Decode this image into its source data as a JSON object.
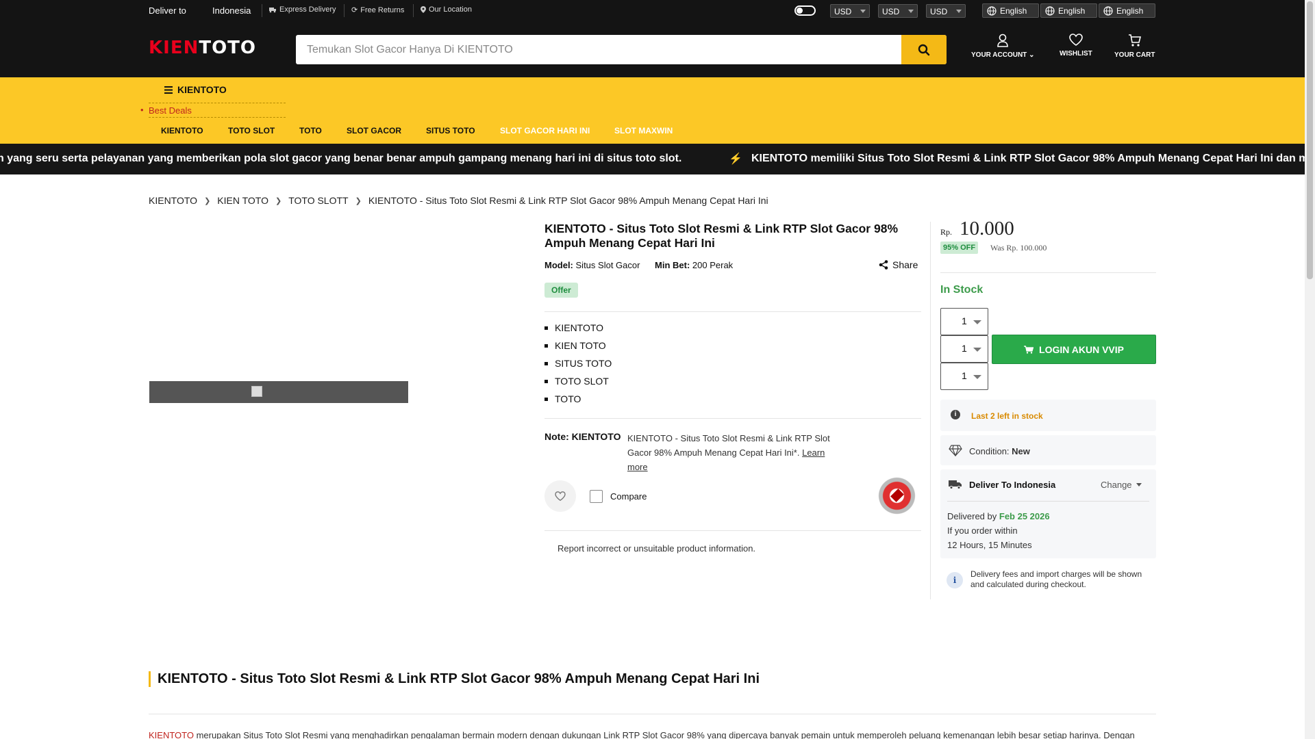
{
  "topbar": {
    "deliver_label": "Deliver to",
    "country": "Indonesia",
    "express": "Express Delivery",
    "returns": "Free Returns",
    "location": "Our Location",
    "currencies": [
      "USD",
      "USD",
      "USD"
    ],
    "languages": [
      "English",
      "English",
      "English"
    ]
  },
  "header": {
    "logo_k": "KIEN",
    "logo_t": "TOTO",
    "search_placeholder": "Temukan Slot Gacor Hanya Di KIENTOTO",
    "account": "YOUR ACCOUNT",
    "wishlist": "WISHLIST",
    "cart": "YOUR CART"
  },
  "nav": {
    "category": "KIENTOTO",
    "best_deals": "Best Deals",
    "links": [
      "KIENTOTO",
      "TOTO SLOT",
      "TOTO",
      "SLOT GACOR",
      "SITUS TOTO",
      "SLOT GACOR HARI INI",
      "SLOT MAXWIN"
    ]
  },
  "marquee": {
    "text1": "n yang seru serta pelayanan yang memberikan pola slot gacor yang benar benar ampuh gampang menang hari ini di situs toto slot.",
    "text2": "KIENTOTO memiliki Situs Toto Slot Resmi & Link RTP Slot Gacor 98% Ampuh Menang Cepat Hari Ini dan m"
  },
  "breadcrumb": [
    "KIENTOTO",
    "KIEN TOTO",
    "TOTO SLOTT",
    "KIENTOTO - Situs Toto Slot Resmi & Link RTP Slot Gacor 98% Ampuh Menang Cepat Hari Ini"
  ],
  "product": {
    "title": "KIENTOTO - Situs Toto Slot Resmi & Link RTP Slot Gacor 98% Ampuh Menang Cepat Hari Ini",
    "model_label": "Model:",
    "model": "Situs Slot Gacor",
    "minbet_label": "Min Bet:",
    "minbet": "200 Perak",
    "share": "Share",
    "offer": "Offer",
    "features": [
      "KIENTOTO",
      "KIEN TOTO",
      "SITUS TOTO",
      "TOTO SLOT",
      "TOTO"
    ],
    "note_label": "Note: KIENTOTO",
    "note_text": "KIENTOTO - Situs Toto Slot Resmi & Link RTP Slot Gacor 98% Ampuh Menang Cepat Hari Ini*.",
    "learn_more": "Learn more",
    "compare": "Compare",
    "report": "Report incorrect or unsuitable product information."
  },
  "buybox": {
    "currency": "Rp.",
    "price": "10.000",
    "discount": "95% OFF",
    "was": "Was Rp. 100.000",
    "stock": "In Stock",
    "qty": [
      "1",
      "1",
      "1"
    ],
    "login_button": "LOGIN AKUN VVIP",
    "last_left": "Last 2 left in stock",
    "condition_label": "Condition:",
    "condition": "New",
    "deliver_to": "Deliver To  Indonesia",
    "change": "Change",
    "delivered_by": "Delivered by",
    "delivered_date": "Feb 25 2026",
    "order_within": "If you order within",
    "countdown": "12 Hours, 15 Minutes",
    "fees": "Delivery fees and import charges will be shown and calculated during checkout."
  },
  "description": {
    "title": "KIENTOTO - Situs Toto Slot Resmi & Link RTP Slot Gacor 98% Ampuh Menang Cepat Hari Ini",
    "lead_red": "KIENTOTO",
    "body": " merupakan Situs Toto Slot Resmi yang menghadirkan pengalaman bermain modern dengan dukungan Link RTP Slot Gacor 98% yang dipercaya banyak pemain untuk memperoleh peluang kemenangan lebih besar setiap harinya. Dengan"
  },
  "colors": {
    "dark": "#141414",
    "yellow": "#fcc826",
    "green": "#2aaa4a",
    "red": "#e8001c"
  }
}
